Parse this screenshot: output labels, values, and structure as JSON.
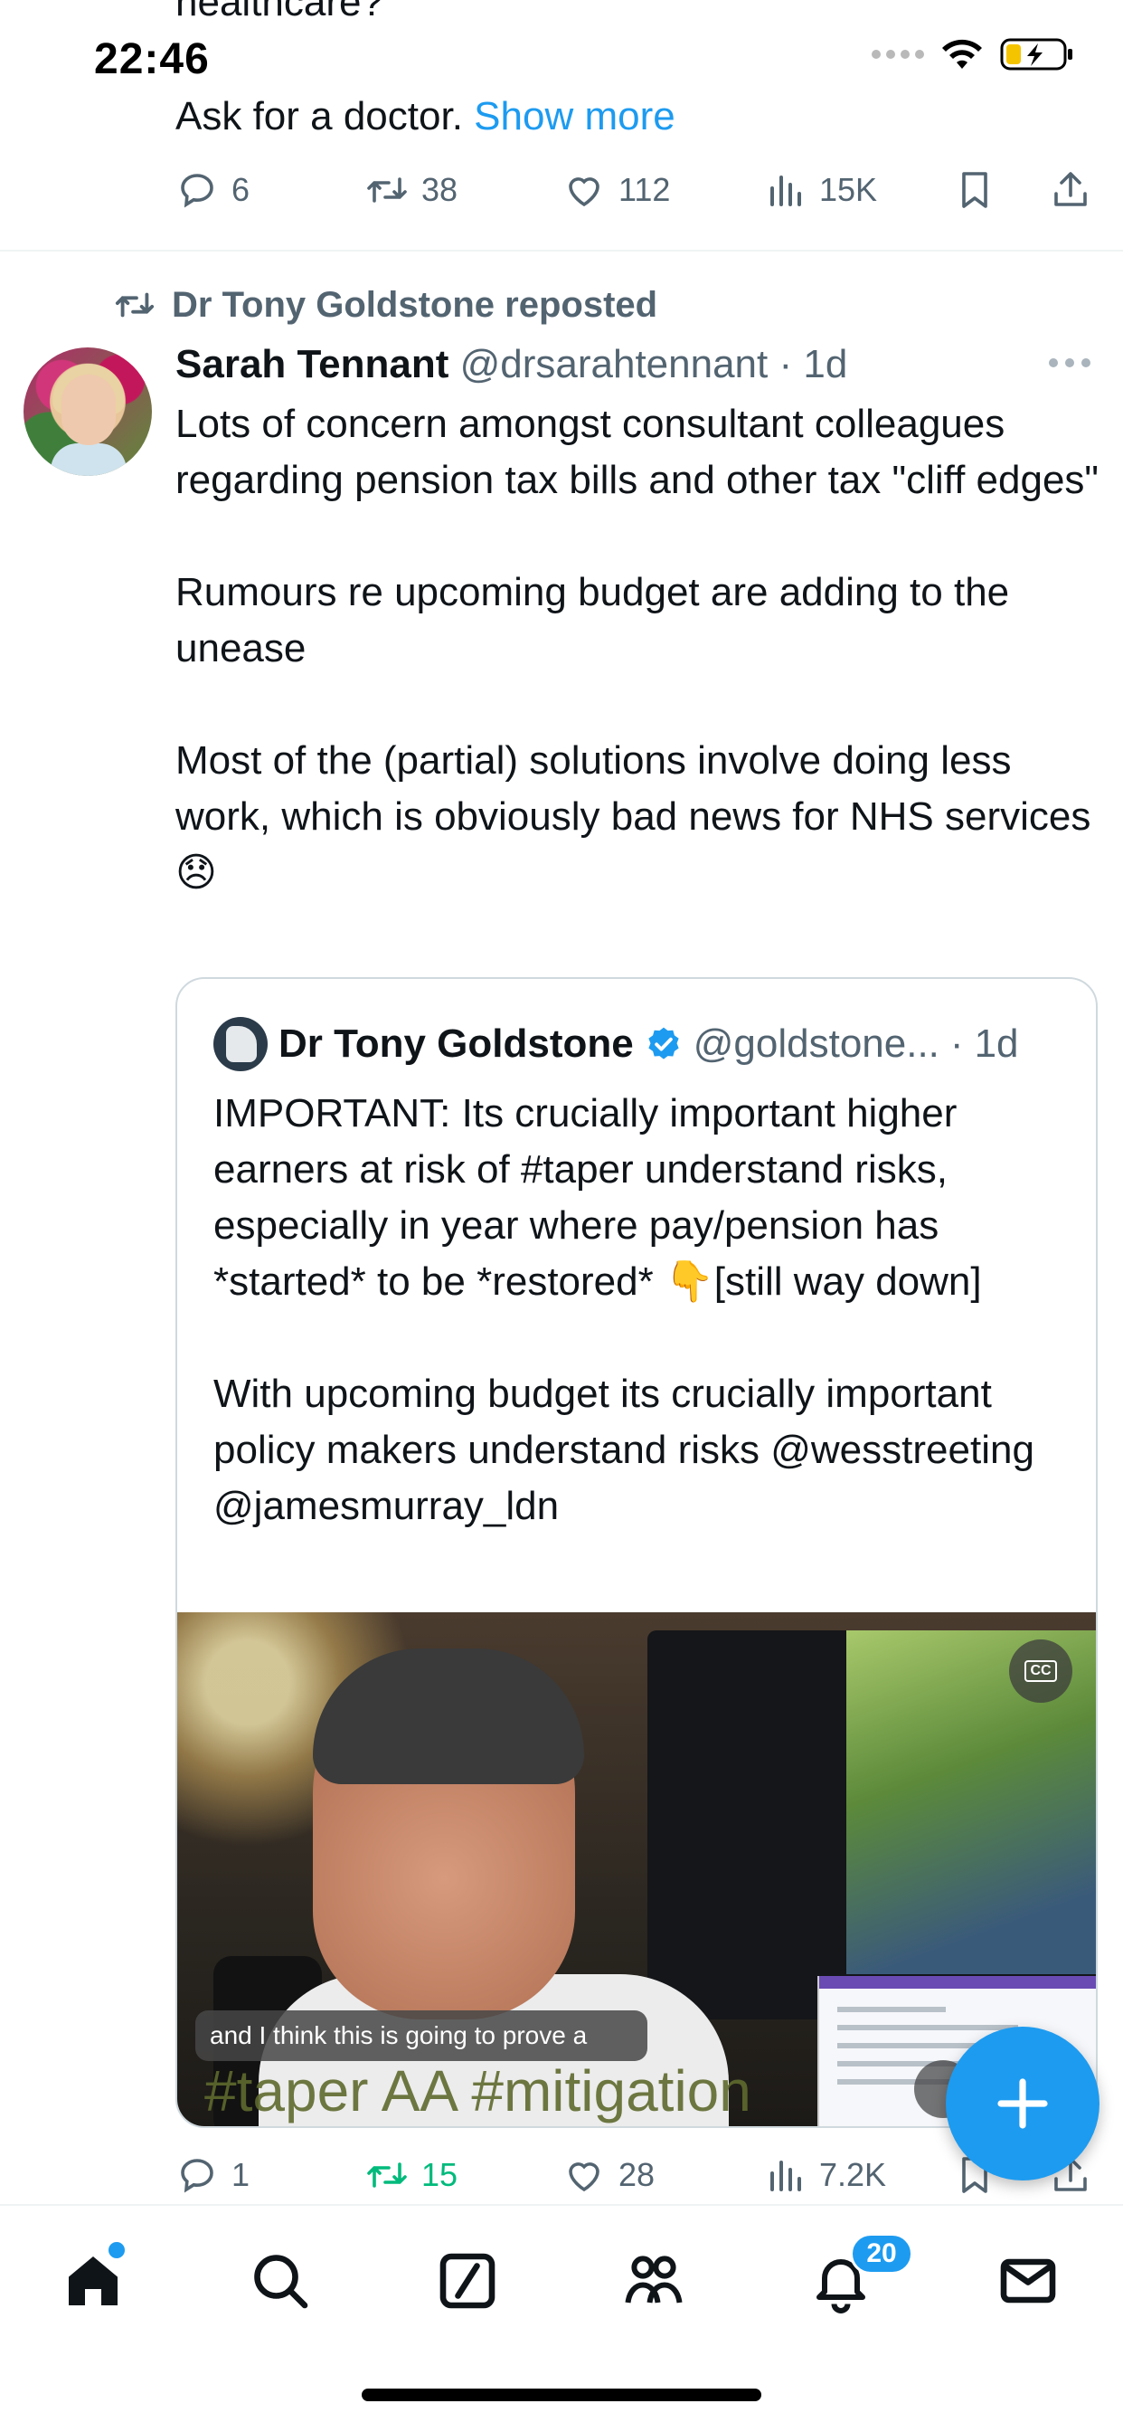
{
  "status_bar": {
    "time": "22:46"
  },
  "previous_tweet": {
    "cut_text": "healthcare?",
    "body": "Ask for a doctor. ",
    "show_more": "Show more",
    "replies": "6",
    "reposts": "38",
    "likes": "112",
    "views": "15K"
  },
  "repost_banner": {
    "text": "Dr Tony Goldstone reposted"
  },
  "tweet": {
    "author_name": "Sarah Tennant",
    "author_handle": "@drsarahtennant",
    "separator": " · ",
    "time": "1d",
    "body": "Lots of concern amongst consultant colleagues regarding pension tax bills and other tax \"cliff edges\"\n\nRumours re upcoming budget are adding to the unease\n\nMost of the (partial) solutions involve doing less work, which is obviously bad news for NHS services 😞",
    "replies": "1",
    "reposts": "15",
    "likes": "28",
    "views": "7.2K"
  },
  "quote": {
    "author_name": "Dr Tony Goldstone",
    "author_handle": "@goldstone...",
    "separator": " · ",
    "time": "1d",
    "body": "IMPORTANT: Its crucially important higher earners at risk of #taper understand risks, especially in year where pay/pension has *started* to be *restored* 👇[still way down]\n\nWith upcoming budget its crucially important policy makers understand risks @wesstreeting @jamesmurray_ldn",
    "video_caption": "and I think this is going to prove a",
    "video_overlay_text": "#taper AA #mitigation",
    "cc_label": "CC"
  },
  "tabbar": {
    "notifications_badge": "20"
  },
  "colors": {
    "accent": "#1d9bf0",
    "repost_green": "#00ba7c",
    "muted": "#536471"
  }
}
